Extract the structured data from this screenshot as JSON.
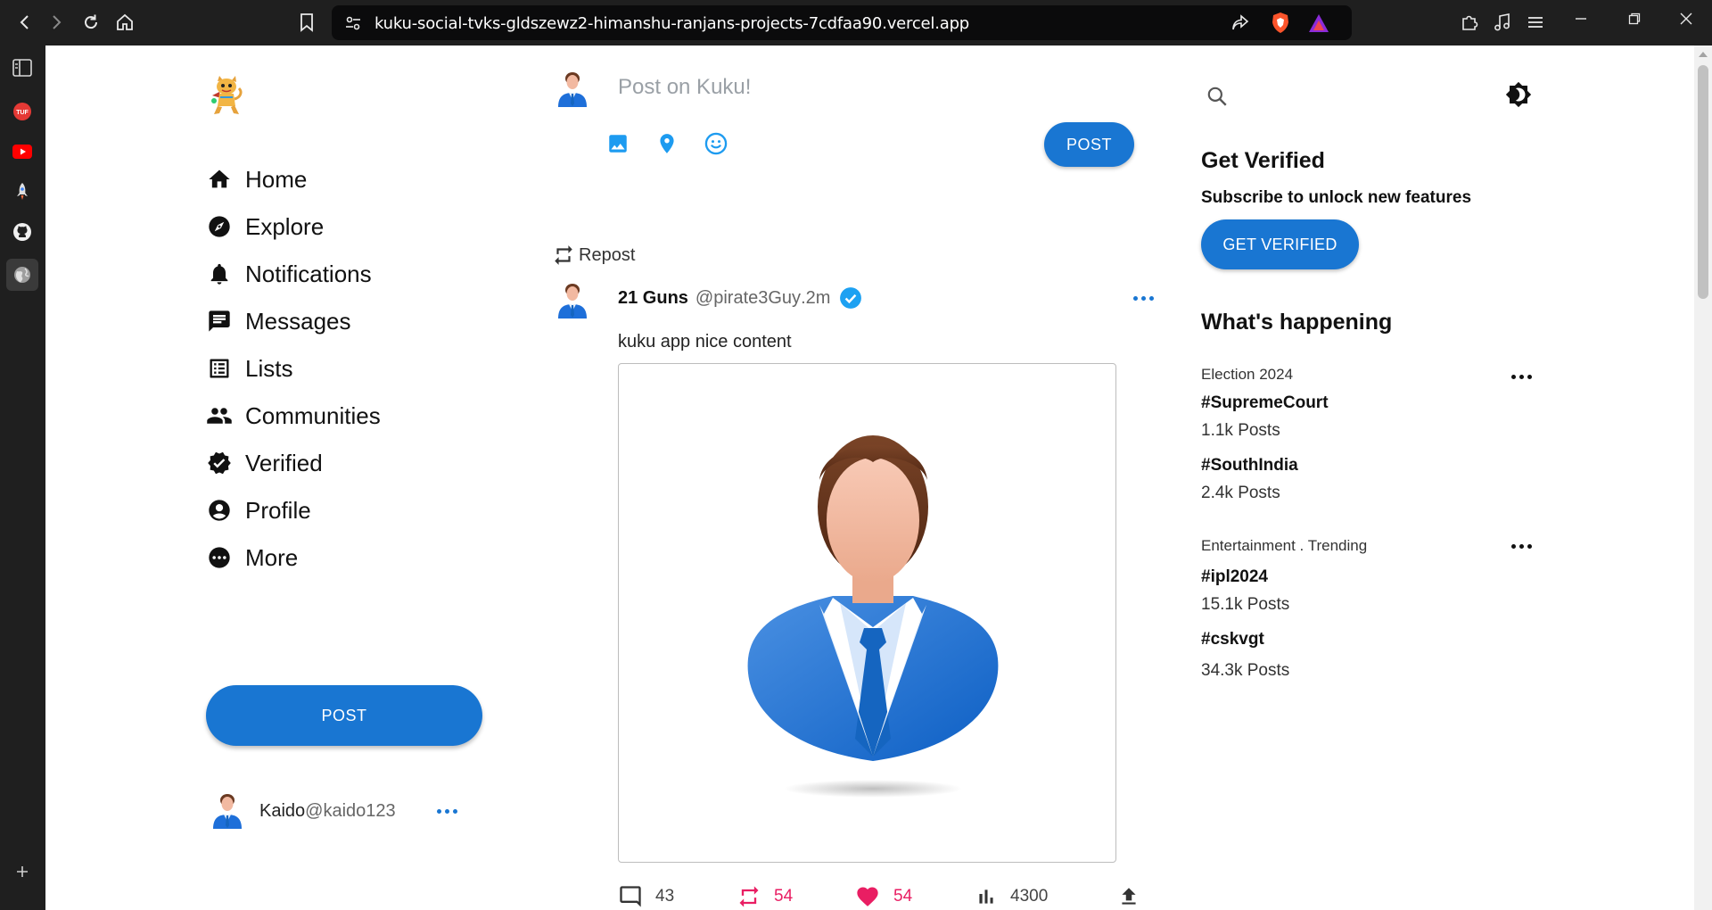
{
  "browser": {
    "url": "kuku-social-tvks-gldszewz2-himanshu-ranjans-projects-7cdfaa90.vercel.app"
  },
  "sidebar_icons": [
    "sidebar-toggle-icon",
    "tuf-icon",
    "youtube-icon",
    "rocket-icon",
    "github-icon",
    "globe-icon",
    "add-icon"
  ],
  "left": {
    "nav": [
      {
        "label": "Home",
        "icon": "home-icon"
      },
      {
        "label": "Explore",
        "icon": "explore-icon"
      },
      {
        "label": "Notifications",
        "icon": "bell-icon"
      },
      {
        "label": "Messages",
        "icon": "message-icon"
      },
      {
        "label": "Lists",
        "icon": "list-icon"
      },
      {
        "label": "Communities",
        "icon": "group-icon"
      },
      {
        "label": "Verified",
        "icon": "verified-icon"
      },
      {
        "label": "Profile",
        "icon": "account-icon"
      },
      {
        "label": "More",
        "icon": "more-icon"
      }
    ],
    "post_button": "POST",
    "account": {
      "name": "Kaido",
      "handle": "@kaido123"
    }
  },
  "compose": {
    "placeholder": "Post on Kuku!",
    "post_button": "POST"
  },
  "tweet": {
    "repost_label": "Repost",
    "name": "21 Guns",
    "handle": "@pirate3Guy",
    "time": ".2m",
    "text": "kuku app nice content",
    "replies": "43",
    "retweets": "54",
    "likes": "54",
    "views": "4300"
  },
  "right": {
    "verified_title": "Get Verified",
    "verified_subtitle": "Subscribe to unlock new features",
    "verified_button": "GET VERIFIED",
    "happening_title": "What's happening",
    "sections": [
      {
        "category": "Election 2024",
        "trends": [
          {
            "tag": "#SupremeCourt",
            "count": "1.1k Posts"
          },
          {
            "tag": "#SouthIndia",
            "count": "2.4k Posts"
          }
        ]
      },
      {
        "category": "Entertainment . Trending",
        "trends": [
          {
            "tag": "#ipl2024",
            "count": "15.1k Posts"
          },
          {
            "tag": "#cskvgt",
            "count": "34.3k Posts"
          }
        ]
      }
    ]
  },
  "colors": {
    "accent": "#1976d2",
    "like": "#e91e63",
    "retweet": "#e91e63",
    "verified": "#1da1f2"
  }
}
